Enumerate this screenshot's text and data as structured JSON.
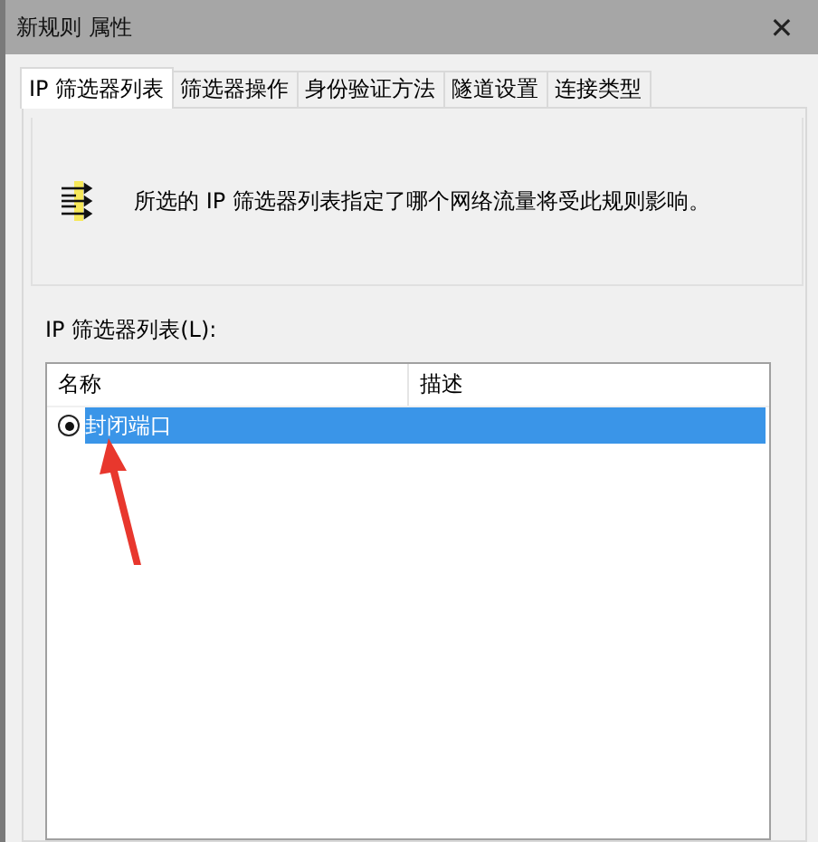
{
  "window": {
    "title": "新规则 属性",
    "close": "✕"
  },
  "tabs": [
    {
      "label": "IP 筛选器列表",
      "selected": true
    },
    {
      "label": "筛选器操作",
      "selected": false
    },
    {
      "label": "身份验证方法",
      "selected": false
    },
    {
      "label": "隧道设置",
      "selected": false
    },
    {
      "label": "连接类型",
      "selected": false
    }
  ],
  "description": "所选的 IP 筛选器列表指定了哪个网络流量将受此规则影响。",
  "list": {
    "label": "IP 筛选器列表(L):",
    "columns": [
      "名称",
      "描述"
    ],
    "rows": [
      {
        "name": "封闭端口",
        "description": "",
        "checked": true,
        "selected": true
      }
    ]
  }
}
